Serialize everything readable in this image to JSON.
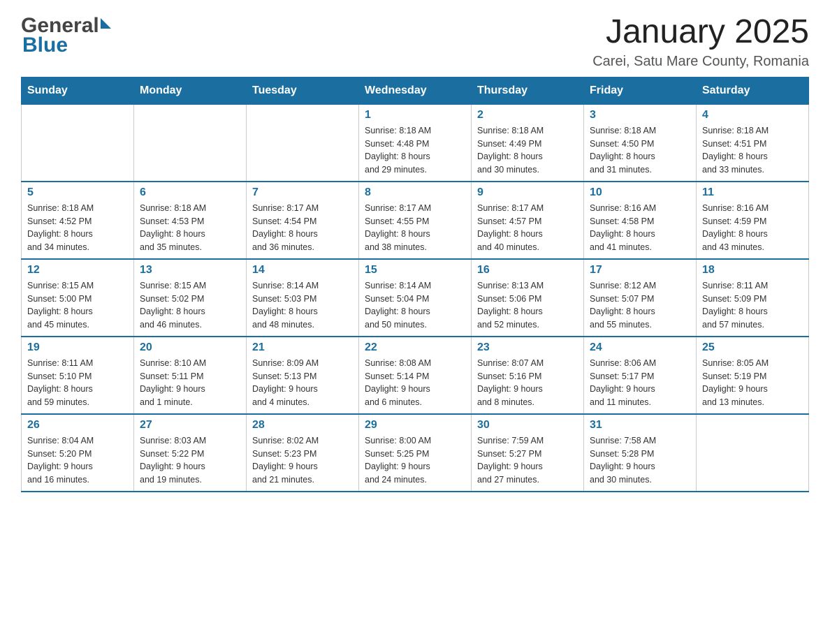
{
  "header": {
    "logo_general": "General",
    "logo_blue": "Blue",
    "title": "January 2025",
    "subtitle": "Carei, Satu Mare County, Romania"
  },
  "calendar": {
    "days_of_week": [
      "Sunday",
      "Monday",
      "Tuesday",
      "Wednesday",
      "Thursday",
      "Friday",
      "Saturday"
    ],
    "weeks": [
      [
        {
          "day": "",
          "info": ""
        },
        {
          "day": "",
          "info": ""
        },
        {
          "day": "",
          "info": ""
        },
        {
          "day": "1",
          "info": "Sunrise: 8:18 AM\nSunset: 4:48 PM\nDaylight: 8 hours\nand 29 minutes."
        },
        {
          "day": "2",
          "info": "Sunrise: 8:18 AM\nSunset: 4:49 PM\nDaylight: 8 hours\nand 30 minutes."
        },
        {
          "day": "3",
          "info": "Sunrise: 8:18 AM\nSunset: 4:50 PM\nDaylight: 8 hours\nand 31 minutes."
        },
        {
          "day": "4",
          "info": "Sunrise: 8:18 AM\nSunset: 4:51 PM\nDaylight: 8 hours\nand 33 minutes."
        }
      ],
      [
        {
          "day": "5",
          "info": "Sunrise: 8:18 AM\nSunset: 4:52 PM\nDaylight: 8 hours\nand 34 minutes."
        },
        {
          "day": "6",
          "info": "Sunrise: 8:18 AM\nSunset: 4:53 PM\nDaylight: 8 hours\nand 35 minutes."
        },
        {
          "day": "7",
          "info": "Sunrise: 8:17 AM\nSunset: 4:54 PM\nDaylight: 8 hours\nand 36 minutes."
        },
        {
          "day": "8",
          "info": "Sunrise: 8:17 AM\nSunset: 4:55 PM\nDaylight: 8 hours\nand 38 minutes."
        },
        {
          "day": "9",
          "info": "Sunrise: 8:17 AM\nSunset: 4:57 PM\nDaylight: 8 hours\nand 40 minutes."
        },
        {
          "day": "10",
          "info": "Sunrise: 8:16 AM\nSunset: 4:58 PM\nDaylight: 8 hours\nand 41 minutes."
        },
        {
          "day": "11",
          "info": "Sunrise: 8:16 AM\nSunset: 4:59 PM\nDaylight: 8 hours\nand 43 minutes."
        }
      ],
      [
        {
          "day": "12",
          "info": "Sunrise: 8:15 AM\nSunset: 5:00 PM\nDaylight: 8 hours\nand 45 minutes."
        },
        {
          "day": "13",
          "info": "Sunrise: 8:15 AM\nSunset: 5:02 PM\nDaylight: 8 hours\nand 46 minutes."
        },
        {
          "day": "14",
          "info": "Sunrise: 8:14 AM\nSunset: 5:03 PM\nDaylight: 8 hours\nand 48 minutes."
        },
        {
          "day": "15",
          "info": "Sunrise: 8:14 AM\nSunset: 5:04 PM\nDaylight: 8 hours\nand 50 minutes."
        },
        {
          "day": "16",
          "info": "Sunrise: 8:13 AM\nSunset: 5:06 PM\nDaylight: 8 hours\nand 52 minutes."
        },
        {
          "day": "17",
          "info": "Sunrise: 8:12 AM\nSunset: 5:07 PM\nDaylight: 8 hours\nand 55 minutes."
        },
        {
          "day": "18",
          "info": "Sunrise: 8:11 AM\nSunset: 5:09 PM\nDaylight: 8 hours\nand 57 minutes."
        }
      ],
      [
        {
          "day": "19",
          "info": "Sunrise: 8:11 AM\nSunset: 5:10 PM\nDaylight: 8 hours\nand 59 minutes."
        },
        {
          "day": "20",
          "info": "Sunrise: 8:10 AM\nSunset: 5:11 PM\nDaylight: 9 hours\nand 1 minute."
        },
        {
          "day": "21",
          "info": "Sunrise: 8:09 AM\nSunset: 5:13 PM\nDaylight: 9 hours\nand 4 minutes."
        },
        {
          "day": "22",
          "info": "Sunrise: 8:08 AM\nSunset: 5:14 PM\nDaylight: 9 hours\nand 6 minutes."
        },
        {
          "day": "23",
          "info": "Sunrise: 8:07 AM\nSunset: 5:16 PM\nDaylight: 9 hours\nand 8 minutes."
        },
        {
          "day": "24",
          "info": "Sunrise: 8:06 AM\nSunset: 5:17 PM\nDaylight: 9 hours\nand 11 minutes."
        },
        {
          "day": "25",
          "info": "Sunrise: 8:05 AM\nSunset: 5:19 PM\nDaylight: 9 hours\nand 13 minutes."
        }
      ],
      [
        {
          "day": "26",
          "info": "Sunrise: 8:04 AM\nSunset: 5:20 PM\nDaylight: 9 hours\nand 16 minutes."
        },
        {
          "day": "27",
          "info": "Sunrise: 8:03 AM\nSunset: 5:22 PM\nDaylight: 9 hours\nand 19 minutes."
        },
        {
          "day": "28",
          "info": "Sunrise: 8:02 AM\nSunset: 5:23 PM\nDaylight: 9 hours\nand 21 minutes."
        },
        {
          "day": "29",
          "info": "Sunrise: 8:00 AM\nSunset: 5:25 PM\nDaylight: 9 hours\nand 24 minutes."
        },
        {
          "day": "30",
          "info": "Sunrise: 7:59 AM\nSunset: 5:27 PM\nDaylight: 9 hours\nand 27 minutes."
        },
        {
          "day": "31",
          "info": "Sunrise: 7:58 AM\nSunset: 5:28 PM\nDaylight: 9 hours\nand 30 minutes."
        },
        {
          "day": "",
          "info": ""
        }
      ]
    ]
  }
}
